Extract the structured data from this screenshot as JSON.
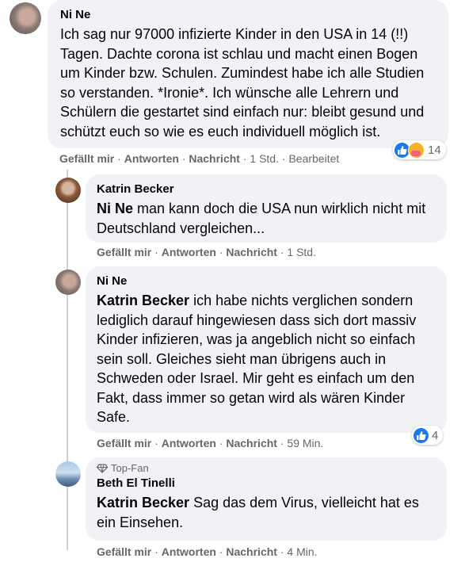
{
  "comments": [
    {
      "author": "Ni Ne",
      "text": "Ich sag nur 97000 infizierte Kinder in den USA in 14 (!!) Tagen. Dachte corona ist schlau und macht einen Bogen um Kinder bzw. Schulen. Zumindest habe ich alle Studien so verstanden. *Ironie*. Ich wünsche alle Lehrern und Schülern die gestartet sind einfach nur: bleibt gesund und schützt euch so wie es euch individuell möglich ist.",
      "actions": {
        "like": "Gefällt mir",
        "reply": "Antworten",
        "message": "Nachricht",
        "time": "1 Std.",
        "edited": "Bearbeitet"
      },
      "reaction_count": "14"
    },
    {
      "author": "Katrin Becker",
      "mention": "Ni Ne",
      "text": " man kann doch die USA nun wirklich nicht mit Deutschland vergleichen...",
      "actions": {
        "like": "Gefällt mir",
        "reply": "Antworten",
        "message": "Nachricht",
        "time": "1 Std."
      }
    },
    {
      "author": "Ni Ne",
      "mention": "Katrin Becker",
      "text": " ich habe nichts verglichen sondern lediglich darauf hingewiesen dass sich dort massiv Kinder infizieren, was ja angeblich nicht so einfach sein soll. Gleiches sieht man übrigens auch in Schweden oder Israel. Mir geht es einfach um den Fakt, dass immer so getan wird als wären Kinder Safe.",
      "actions": {
        "like": "Gefällt mir",
        "reply": "Antworten",
        "message": "Nachricht",
        "time": "59 Min."
      },
      "reaction_count": "4"
    },
    {
      "badge": "Top-Fan",
      "author": "Beth El Tinelli",
      "mention": "Katrin Becker",
      "text": " Sag das dem Virus, vielleicht hat es ein Einsehen.",
      "actions": {
        "like": "Gefällt mir",
        "reply": "Antworten",
        "message": "Nachricht",
        "time": "4 Min."
      }
    }
  ],
  "separator": "·",
  "colors": {
    "bubble": "#f0f2f5",
    "meta": "#65676b",
    "like": "#1877f2"
  }
}
